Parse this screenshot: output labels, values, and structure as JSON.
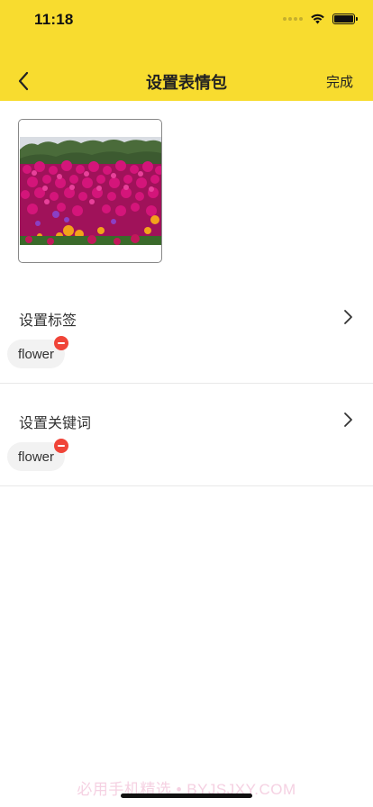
{
  "status_bar": {
    "time": "11:18",
    "battery_level": 1.0
  },
  "nav": {
    "back_icon": "chevron-left-icon",
    "title": "设置表情包",
    "done_label": "完成"
  },
  "image": {
    "content": "flower-photo"
  },
  "tags_section": {
    "label": "设置标签",
    "tags": [
      "flower"
    ]
  },
  "keywords_section": {
    "label": "设置关键词",
    "keywords": [
      "flower"
    ]
  },
  "watermark": "必用手机精选 • BYJSJXY.COM",
  "colors": {
    "header": "#f8dc2f",
    "remove_badge": "#f04438",
    "tag_background": "#f2f2f2"
  }
}
